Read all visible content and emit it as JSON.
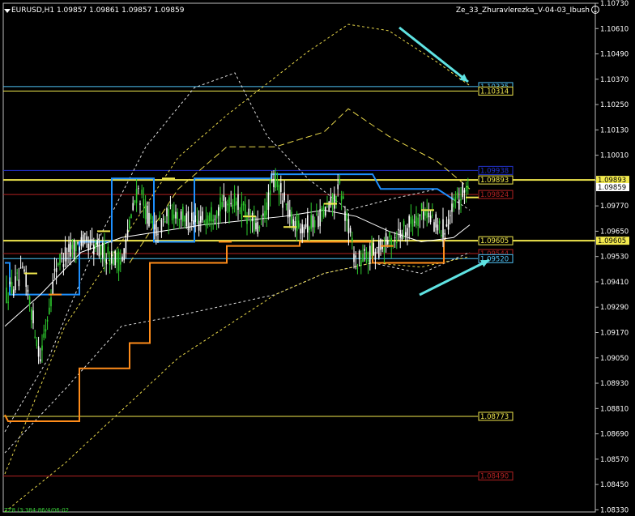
{
  "window": {
    "symbol_header": "EURUSD,H1  1.09857 1.09861 1.09857 1.09859",
    "indicator_name": "Ze_33_Zhuravlerezka_V-04-03_Ibush",
    "footer_label": "ZZ8 (3:384-86/4/06-02"
  },
  "colors": {
    "background": "#000000",
    "grid_line": "#404040",
    "candle_up": "#2ecc2e",
    "candle_down": "#ffffff",
    "level_yellow": "#f2e94e",
    "level_red": "#b22222",
    "level_cyan": "#4fc3f7",
    "level_blue": "#2233cc",
    "channel_orange": "#ff8c1a",
    "channel_blue": "#1e90ff",
    "band_white": "#dddddd",
    "band_yellow": "#e8d74a",
    "arrow_cyan": "#5fe3e3"
  },
  "chart_data": {
    "type": "candlestick",
    "symbol": "EURUSD",
    "timeframe": "H1",
    "ohlc_last": {
      "open": 1.09857,
      "high": 1.09861,
      "low": 1.09857,
      "close": 1.09859
    },
    "ylim": [
      1.0832,
      1.1073
    ],
    "y_ticks": [
      "1.10730",
      "1.10610",
      "1.10490",
      "1.10370",
      "1.10250",
      "1.10130",
      "1.10010",
      "1.09890",
      "1.09770",
      "1.09650",
      "1.09530",
      "1.09410",
      "1.09290",
      "1.09170",
      "1.09050",
      "1.08930",
      "1.08810",
      "1.08690",
      "1.08570",
      "1.08450",
      "1.08330"
    ],
    "current_price_label": "1.09859",
    "levels": [
      {
        "price": 1.10335,
        "label": "1.10335",
        "color": "#4fc3f7"
      },
      {
        "price": 1.10314,
        "label": "1.10314",
        "color": "#f2e94e"
      },
      {
        "price": 1.09938,
        "label": "1.09938",
        "color": "#2233cc"
      },
      {
        "price": 1.09893,
        "label": "1.09893",
        "color": "#f2e94e"
      },
      {
        "price": 1.09824,
        "label": "1.09824",
        "color": "#b22222"
      },
      {
        "price": 1.09605,
        "label": "1.09605",
        "color": "#f2e94e"
      },
      {
        "price": 1.09544,
        "label": "1.09544",
        "color": "#b22222"
      },
      {
        "price": 1.0952,
        "label": "1.09520",
        "color": "#4fc3f7"
      },
      {
        "price": 1.08773,
        "label": "1.08773",
        "color": "#f2e94e"
      },
      {
        "price": 1.0849,
        "label": "1.08490",
        "color": "#b22222"
      }
    ]
  }
}
